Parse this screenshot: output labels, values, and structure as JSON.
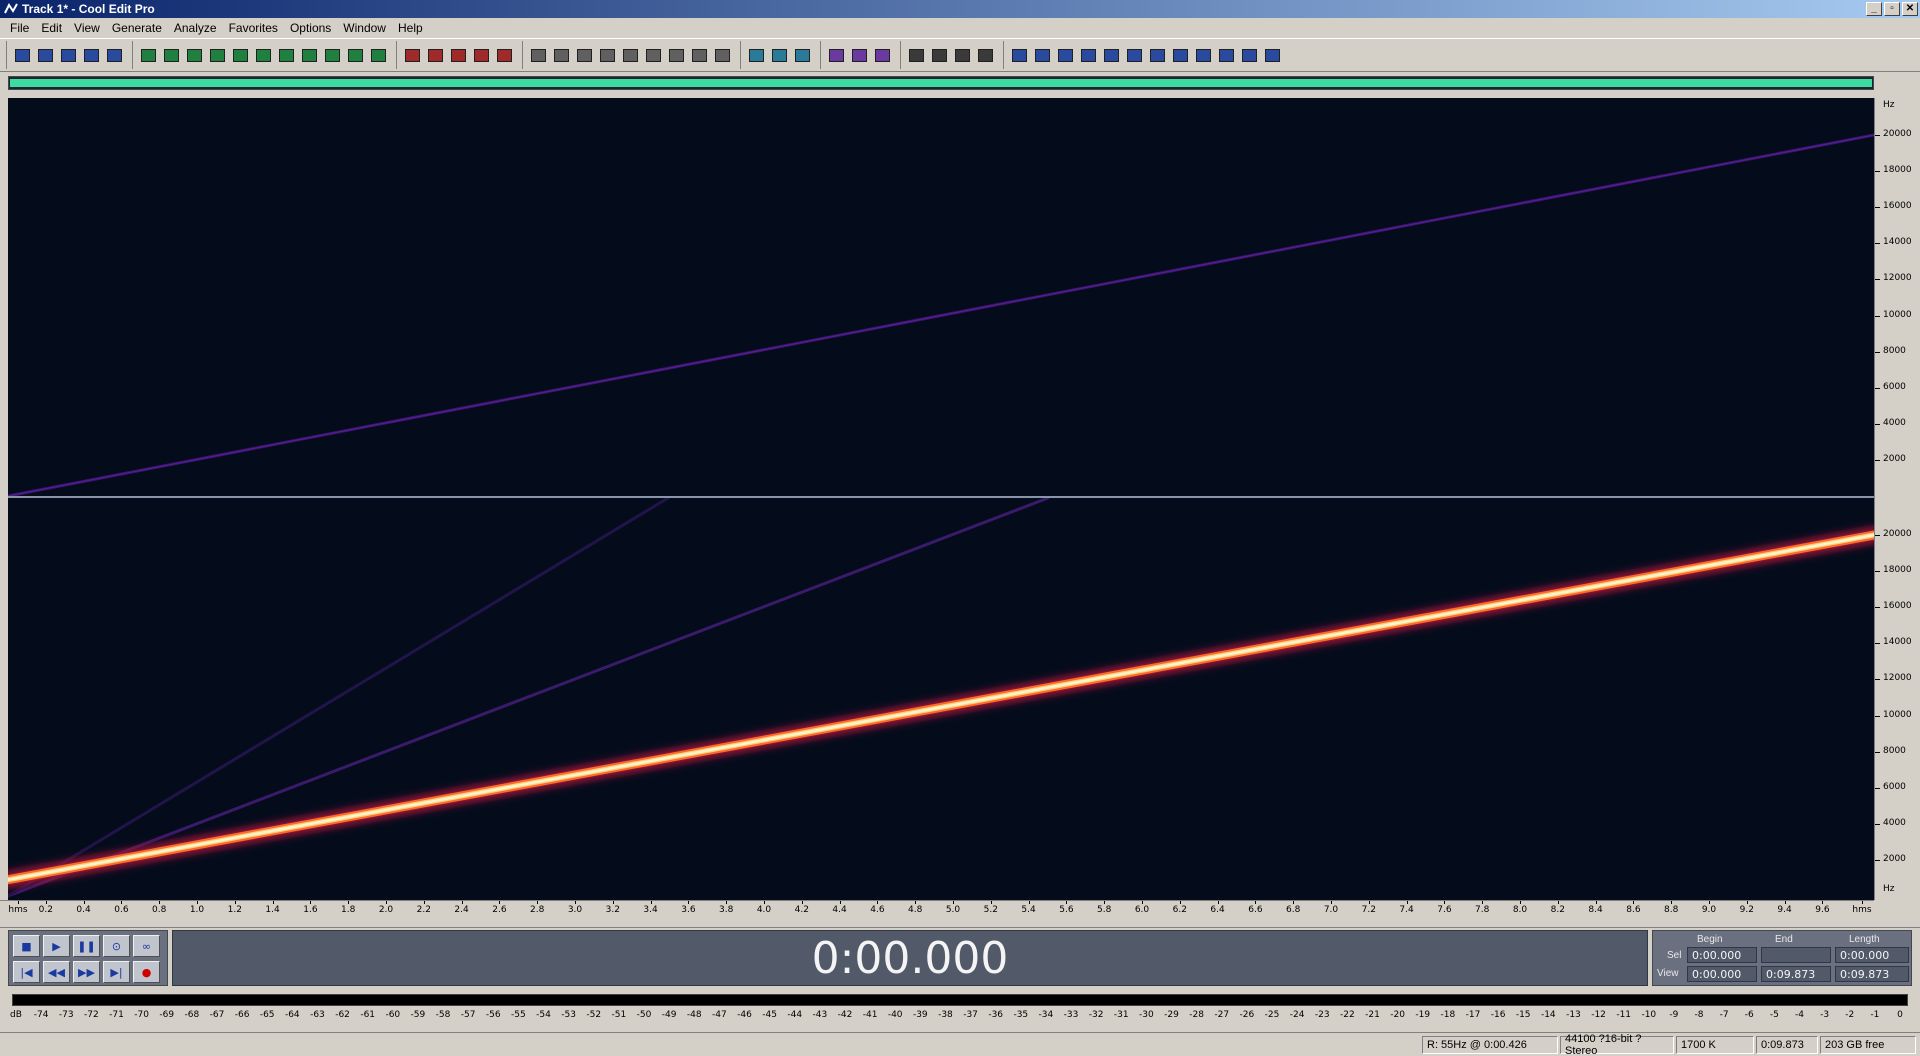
{
  "window": {
    "title": "Track 1* - Cool Edit Pro",
    "controls": [
      "_",
      "▫",
      "✕"
    ]
  },
  "menu": [
    "File",
    "Edit",
    "View",
    "Generate",
    "Analyze",
    "Favorites",
    "Options",
    "Window",
    "Help"
  ],
  "toolbar_groups": [
    [
      "view-toggle",
      "open",
      "open-append",
      "save",
      "save-as"
    ],
    [
      "undo",
      "redo",
      "cut-knife",
      "copy",
      "paste",
      "trim",
      "split",
      "fit",
      "zoom-full",
      "loop",
      "envelope"
    ],
    [
      "waveform-view",
      "spectral-view",
      "edit-view",
      "multitrack",
      "cd-view"
    ],
    [
      "mixer",
      "properties",
      "snap",
      "play",
      "zoom",
      "time-format",
      "tempo",
      "grid",
      "markers"
    ],
    [
      "effects",
      "favorites",
      "help"
    ],
    [
      "spectrum",
      "search",
      "zoom-in"
    ],
    [
      "graphic-eq",
      "filter",
      "parametric",
      "noise"
    ],
    [
      "hard-limit",
      "fade",
      "normalize",
      "amplify",
      "delay",
      "reverb",
      "chorus",
      "flanger",
      "sweep",
      "stretch",
      "phase",
      "settings"
    ]
  ],
  "spectral": {
    "channels": 2,
    "frequency_unit": "Hz",
    "frequency_ticks": [
      "20000",
      "18000",
      "16000",
      "14000",
      "12000",
      "10000",
      "8000",
      "6000",
      "4000",
      "2000"
    ],
    "sweep_start_hz": 0,
    "sweep_end_hz": 20000,
    "duration_s": 9.873
  },
  "time_ruler": {
    "unit": "hms",
    "labels": [
      "hms",
      "0.2",
      "0.4",
      "0.6",
      "0.8",
      "1.0",
      "1.2",
      "1.4",
      "1.6",
      "1.8",
      "2.0",
      "2.2",
      "2.4",
      "2.6",
      "2.8",
      "3.0",
      "3.2",
      "3.4",
      "3.6",
      "3.8",
      "4.0",
      "4.2",
      "4.4",
      "4.6",
      "4.8",
      "5.0",
      "5.2",
      "5.4",
      "5.6",
      "5.8",
      "6.0",
      "6.2",
      "6.4",
      "6.6",
      "6.8",
      "7.0",
      "7.2",
      "7.4",
      "7.6",
      "7.8",
      "8.0",
      "8.2",
      "8.4",
      "8.6",
      "8.8",
      "9.0",
      "9.2",
      "9.4",
      "9.6",
      "hms"
    ]
  },
  "transport": {
    "row1": [
      "stop",
      "play",
      "pause",
      "play-to-end",
      "loop"
    ],
    "row2": [
      "go-begin",
      "rewind",
      "fast-forward",
      "go-end",
      "record"
    ]
  },
  "time_display": "0:00.000",
  "selection": {
    "headers": [
      "Begin",
      "End",
      "Length"
    ],
    "sel_label": "Sel",
    "view_label": "View",
    "sel_begin": "0:00.000",
    "sel_end": "",
    "sel_length": "0:00.000",
    "view_begin": "0:00.000",
    "view_end": "0:09.873",
    "view_length": "0:09.873"
  },
  "level_meter": {
    "labels": [
      "dB",
      "-74",
      "-73",
      "-72",
      "-71",
      "-70",
      "-69",
      "-68",
      "-67",
      "-66",
      "-65",
      "-64",
      "-63",
      "-62",
      "-61",
      "-60",
      "-59",
      "-58",
      "-57",
      "-56",
      "-55",
      "-54",
      "-53",
      "-52",
      "-51",
      "-50",
      "-49",
      "-48",
      "-47",
      "-46",
      "-45",
      "-44",
      "-43",
      "-42",
      "-41",
      "-40",
      "-39",
      "-38",
      "-37",
      "-36",
      "-35",
      "-34",
      "-33",
      "-32",
      "-31",
      "-30",
      "-29",
      "-28",
      "-27",
      "-26",
      "-25",
      "-24",
      "-23",
      "-22",
      "-21",
      "-20",
      "-19",
      "-18",
      "-17",
      "-16",
      "-15",
      "-14",
      "-13",
      "-12",
      "-11",
      "-10",
      "-9",
      "-8",
      "-7",
      "-6",
      "-5",
      "-4",
      "-3",
      "-2",
      "-1",
      "0"
    ]
  },
  "status": {
    "cursor": "R: 55Hz @   0:00.426",
    "format": "44100 ?16-bit ?Stereo",
    "size": "1700 K",
    "duration": "0:09.873",
    "disk": "203 GB free"
  },
  "colors": {
    "spectral_bg": "#040c1c",
    "sweep_core": "#fff4c8",
    "sweep_glow": "#ff6a28",
    "harmonic": "#3a1a6a",
    "overview": "#3cdca0"
  }
}
